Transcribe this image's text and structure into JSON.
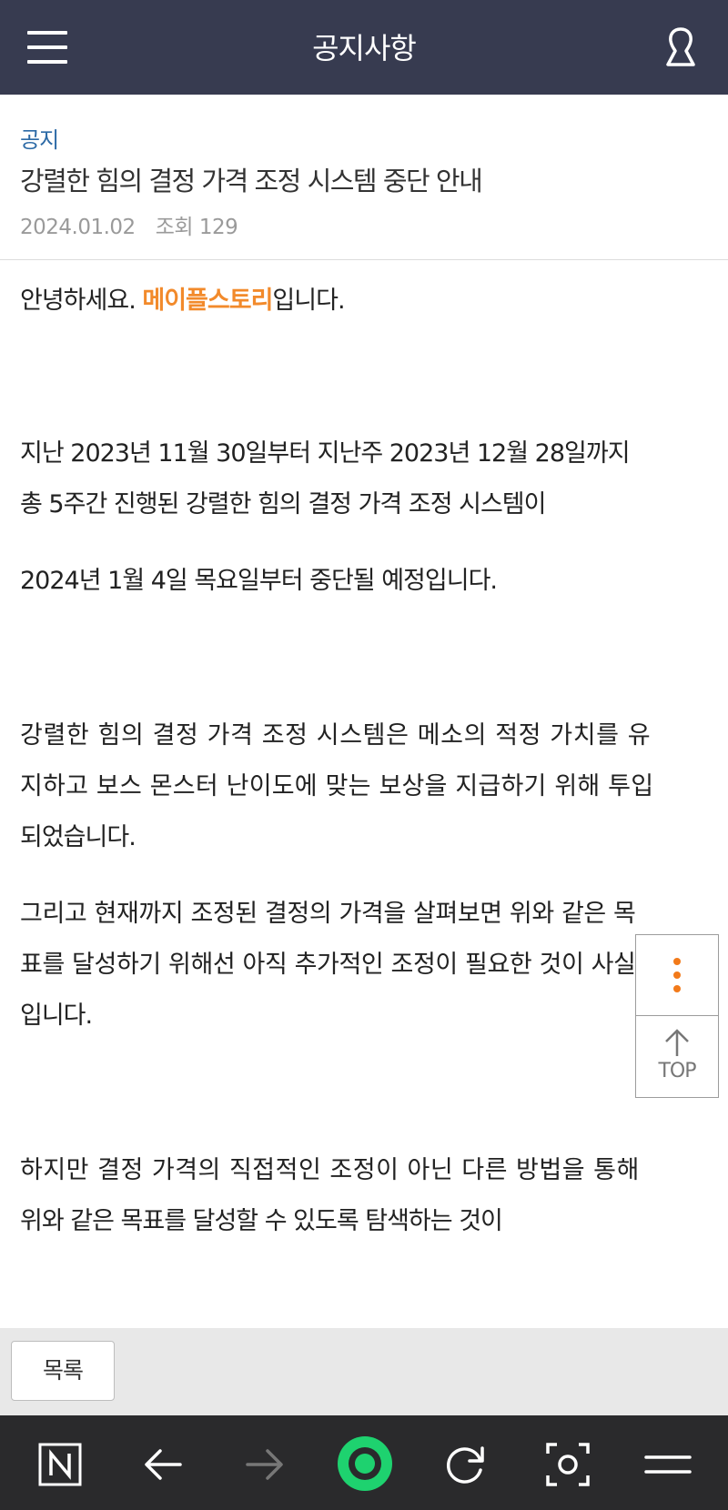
{
  "header": {
    "title": "공지사항"
  },
  "post": {
    "category": "공지",
    "title": "강렬한 힘의 결정 가격 조정 시스템 중단 안내",
    "date": "2024.01.02",
    "views": "조회 129"
  },
  "content": {
    "greeting_pre": "안녕하세요. ",
    "greeting_brand": "메이플스토리",
    "greeting_post": "입니다.",
    "lines": [
      "지난 2023년 11월 30일부터 지난주 2023년 12월 28일까지",
      "총 5주간 진행된 강렬한 힘의 결정 가격 조정 시스템이",
      "2024년 1월 4일 목요일부터 중단될 예정입니다.",
      "강렬한 힘의 결정 가격 조정 시스템은 메소의 적정 가치를 유",
      "지하고 보스 몬스터 난이도에 맞는 보상을 지급하기 위해 투입",
      "되었습니다.",
      "그리고 현재까지 조정된 결정의 가격을 살펴보면 위와 같은 목",
      "표를 달성하기 위해선 아직 추가적인 조정이 필요한 것이 사실",
      "입니다.",
      "하지만 결정 가격의 직접적인 조정이 아닌 다른 방법을 통해",
      "위와 같은 목표를 달성할 수 있도록 탐색하는 것이"
    ]
  },
  "side_widget": {
    "top_label": "TOP"
  },
  "list_button": {
    "label": "목록"
  },
  "colors": {
    "header_bg": "#373b50",
    "category": "#2c6aa6",
    "brand_highlight": "#f28a2b",
    "browser_accent": "#1ed26f"
  },
  "browser_bar": {
    "icons": [
      "naver-home-icon",
      "back-arrow-icon",
      "forward-arrow-icon",
      "green-dot-icon",
      "reload-icon",
      "screenshot-icon",
      "menu-icon"
    ]
  }
}
